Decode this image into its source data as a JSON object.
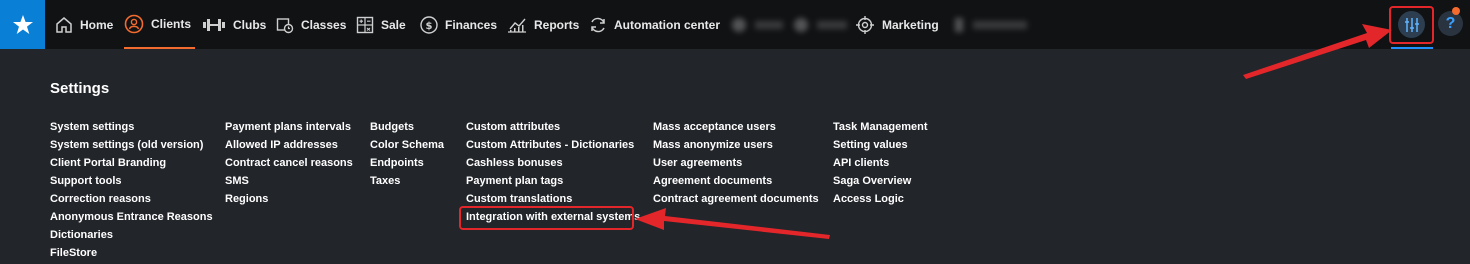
{
  "nav": {
    "home": "Home",
    "clients": "Clients",
    "clubs": "Clubs",
    "classes": "Classes",
    "sale": "Sale",
    "finances": "Finances",
    "reports": "Reports",
    "automation": "Automation center",
    "marketing": "Marketing",
    "active": "Clients"
  },
  "help_label": "?",
  "settings": {
    "title": "Settings",
    "columns": [
      [
        "System settings",
        "System settings (old version)",
        "Client Portal Branding",
        "Support tools",
        "Correction reasons",
        "Anonymous Entrance Reasons",
        "Dictionaries",
        "FileStore"
      ],
      [
        "Payment plans intervals",
        "Allowed IP addresses",
        "Contract cancel reasons",
        "SMS",
        "Regions"
      ],
      [
        "Budgets",
        "Color Schema",
        "Endpoints",
        "Taxes"
      ],
      [
        "Custom attributes",
        "Custom Attributes - Dictionaries",
        "Cashless bonuses",
        "Payment plan tags",
        "Custom translations",
        "Integration with external systems"
      ],
      [
        "Mass acceptance users",
        "Mass anonymize users",
        "User agreements",
        "Agreement documents",
        "Contract agreement documents"
      ],
      [
        "Task Management",
        "Setting values",
        "API clients",
        "Saga Overview",
        "Access Logic"
      ]
    ]
  },
  "colors": {
    "accent": "#f36b2e",
    "logo_bg": "#0a7fd6",
    "highlight": "#e3262a",
    "underline": "#1e90ff"
  }
}
